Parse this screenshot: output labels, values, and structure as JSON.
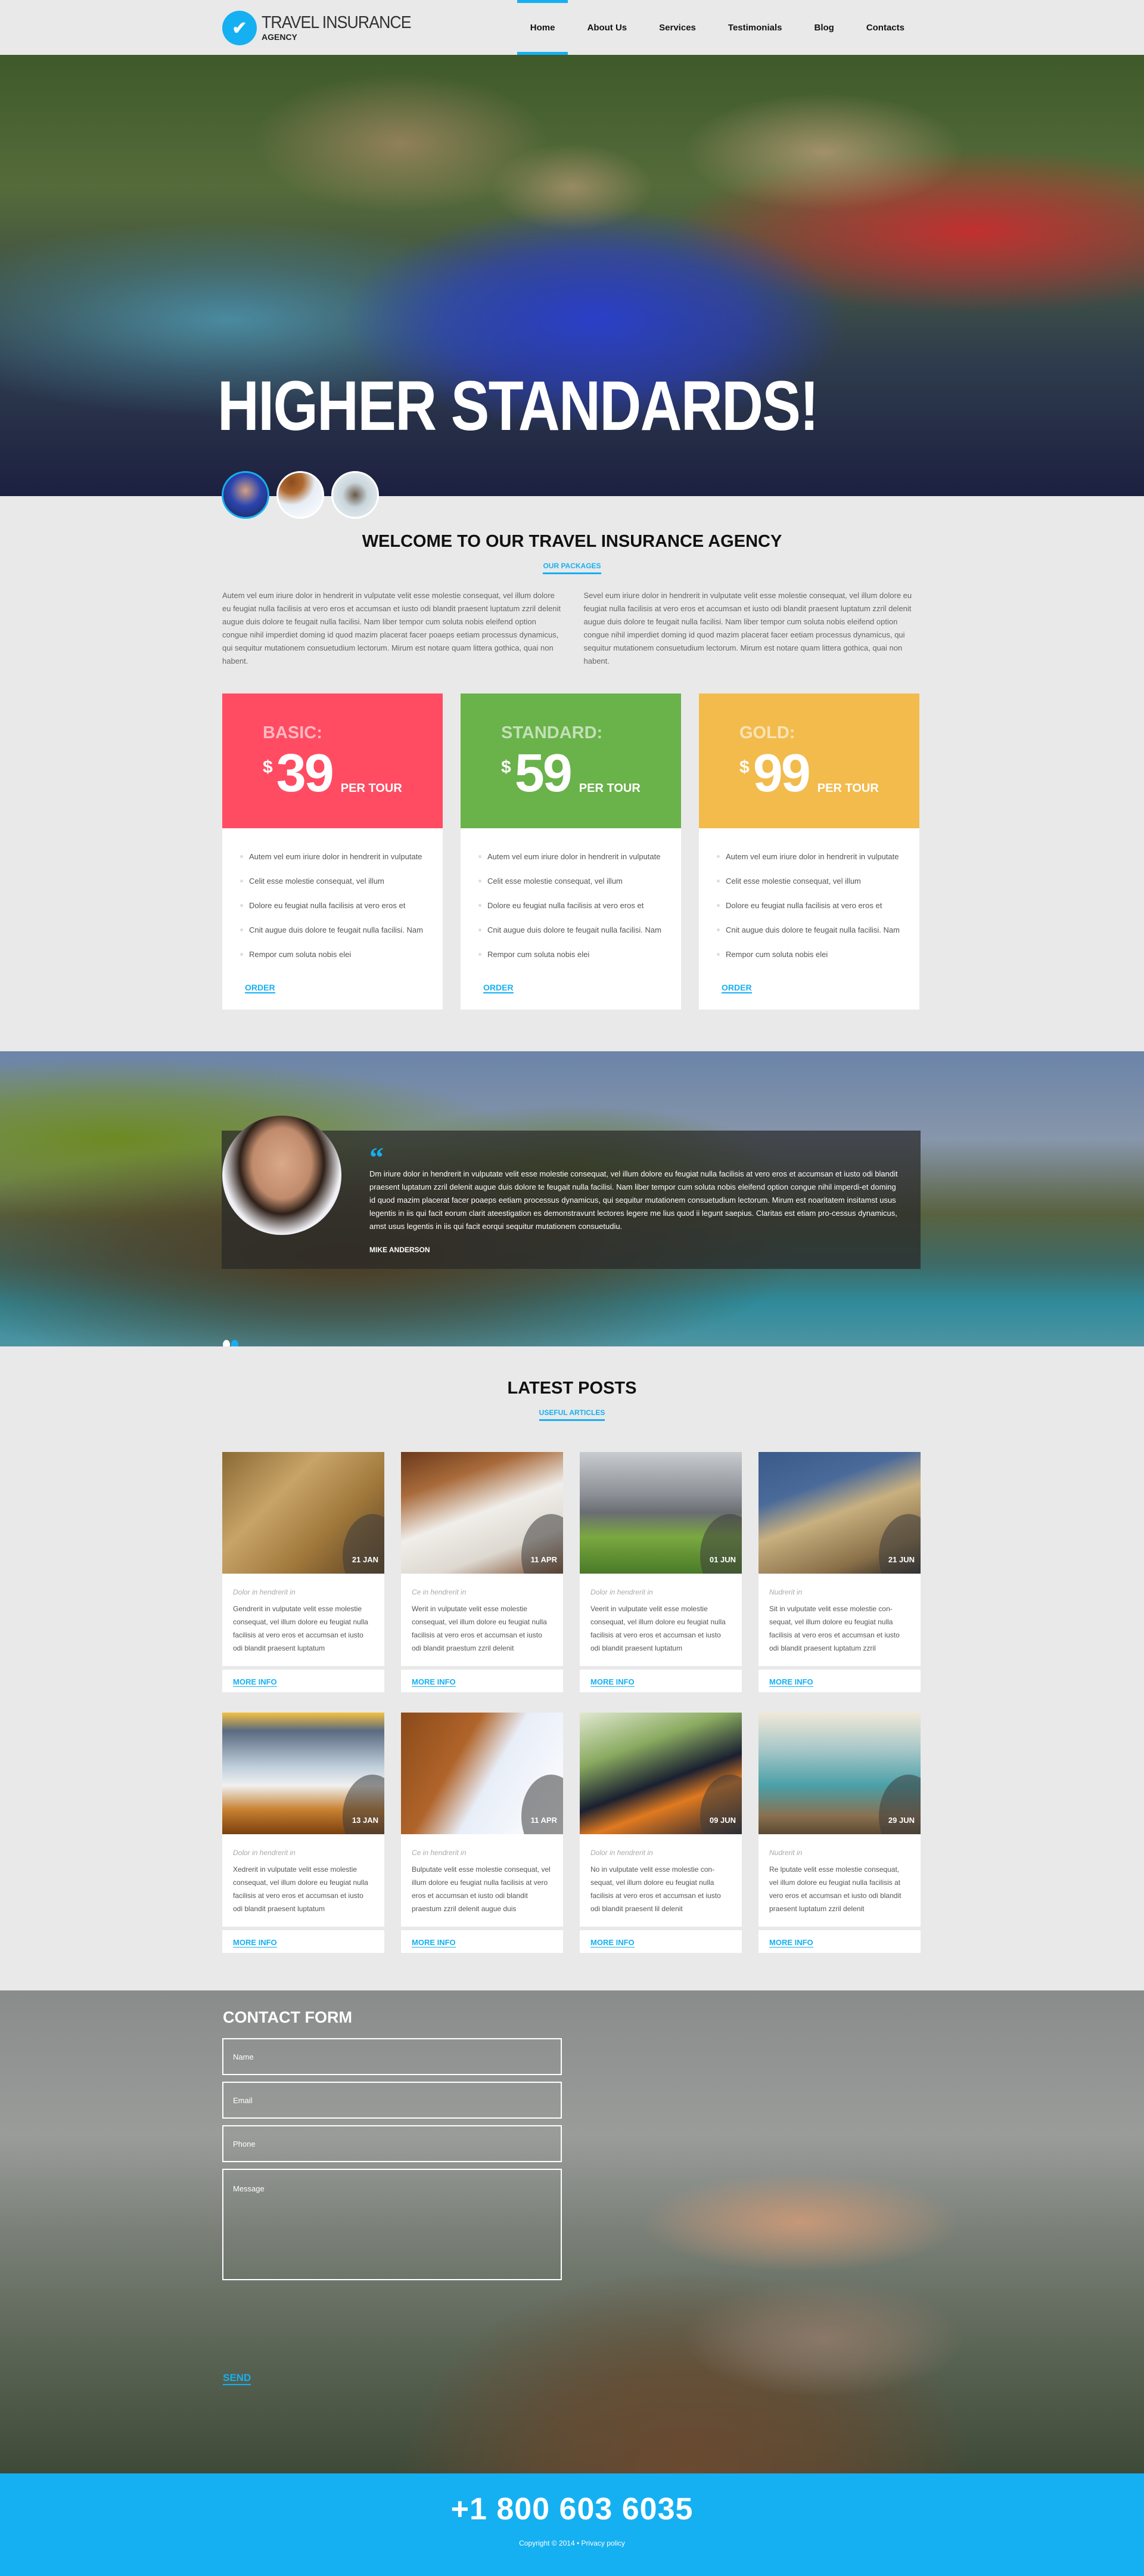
{
  "header": {
    "logo_title": "TRAVEL INSURANCE",
    "logo_subtitle": "AGENCY",
    "logo_icon": "check-icon",
    "nav": [
      {
        "label": "Home",
        "active": true
      },
      {
        "label": "About Us",
        "active": false
      },
      {
        "label": "Services",
        "active": false
      },
      {
        "label": "Testimonials",
        "active": false
      },
      {
        "label": "Blog",
        "active": false
      },
      {
        "label": "Contacts",
        "active": false
      }
    ]
  },
  "hero": {
    "title": "HIGHER STANDARDS!",
    "slide_count": 3,
    "active_slide": 1
  },
  "welcome": {
    "title": "WELCOME TO OUR TRAVEL INSURANCE AGENCY",
    "link": "OUR PACKAGES",
    "col1": "Autem vel eum iriure dolor in hendrerit in vulputate velit esse molestie consequat, vel illum dolore eu feugiat nulla facilisis at vero eros et accumsan et iusto odi blandit praesent luptatum zzril delenit augue duis dolore te feugait nulla facilisi. Nam liber tempor cum soluta nobis eleifend option congue nihil imperdiet doming id quod mazim placerat facer poaeps eetiam processus dynamicus, qui sequitur mutationem consuetudium lectorum. Mirum est notare quam littera gothica, quai non habent.",
    "col2": "Sevel eum iriure dolor in hendrerit in vulputate velit esse molestie consequat, vel illum dolore eu feugiat nulla facilisis at vero eros et accumsan et iusto odi blandit praesent luptatum zzril delenit augue duis dolore te feugait nulla facilisi. Nam liber tempor cum soluta nobis eleifend option congue nihil imperdiet doming id quod mazim placerat facer  eetiam processus dynamicus, qui sequitur mutationem consuetudium lectorum. Mirum est notare quam littera gothica, quai non habent."
  },
  "pricing": [
    {
      "name": "BASIC:",
      "currency": "$",
      "amount": "39",
      "per": "PER TOUR",
      "color": "#ff4c63",
      "features": [
        "Autem vel eum iriure dolor in hendrerit in vulputate",
        "Celit esse molestie consequat, vel illum",
        "Dolore eu feugiat nulla facilisis at vero eros et",
        "Cnit augue duis dolore te feugait nulla facilisi. Nam",
        "Rempor cum soluta nobis elei"
      ],
      "order": "ORDER"
    },
    {
      "name": "STANDARD:",
      "currency": "$",
      "amount": "59",
      "per": "PER TOUR",
      "color": "#6ab24a",
      "features": [
        "Autem vel eum iriure dolor in hendrerit in vulputate",
        "Celit esse molestie consequat, vel illum",
        "Dolore eu feugiat nulla facilisis at vero eros et",
        "Cnit augue duis dolore te feugait nulla facilisi. Nam",
        "Rempor cum soluta nobis elei"
      ],
      "order": "ORDER"
    },
    {
      "name": "GOLD:",
      "currency": "$",
      "amount": "99",
      "per": "PER TOUR",
      "color": "#f2bb4c",
      "features": [
        "Autem vel eum iriure dolor in hendrerit in vulputate",
        "Celit esse molestie consequat, vel illum",
        "Dolore eu feugiat nulla facilisis at vero eros et",
        "Cnit augue duis dolore te feugait nulla facilisi. Nam",
        "Rempor cum soluta nobis elei"
      ],
      "order": "ORDER"
    }
  ],
  "testimonial": {
    "quote_mark": "“",
    "text": "Dm iriure dolor in hendrerit in vulputate velit esse molestie consequat, vel illum dolore eu feugiat nulla facilisis at vero eros et accumsan et iusto odi blandit praesent luptatum zzril delenit augue duis dolore te feugait nulla facilisi. Nam liber tempor cum soluta nobis eleifend option congue nihil imperdi-et doming id quod mazim placerat facer poaeps eetiam processus dynamicus, qui sequitur mutationem consuetudium lectorum. Mirum est noaritatem insitamst usus legentis in iis qui facit eorum clarit ateestigation es demonstravunt lectores legere me lius quod ii legunt saepius. Claritas est etiam pro-cessus dynamicus, amst usus legentis in iis qui facit eorqui sequitur mutationem consuetudiu.",
    "author": "MIKE ANDERSON",
    "slide_count": 2,
    "active_slide": 2
  },
  "posts": {
    "title": "LATEST POSTS",
    "link": "USEFUL ARTICLES",
    "more_label": "MORE INFO",
    "items": [
      {
        "date": "21 JAN",
        "category": "Dolor in hendrerit in",
        "text": "Gendrerit in vulputate velit esse molestie consequat, vel illum dolore eu feugiat nulla facilisis at vero eros et accumsan et iusto odi blandit praesent luptatum"
      },
      {
        "date": "11 APR",
        "category": "Ce in hendrerit in",
        "text": "Werit in vulputate velit esse molestie consequat, vel illum dolore eu feugiat nulla facilisis at vero eros et accumsan et iusto odi blandit praestum zzril delenit"
      },
      {
        "date": "01 JUN",
        "category": "Dolor in hendrerit in",
        "text": "Veerit in vulputate velit esse molestie consequat, vel illum dolore eu feugiat nulla facilisis at vero eros et accumsan et iusto odi blandit praesent luptatum"
      },
      {
        "date": "21 JUN",
        "category": "Nudrerit in",
        "text": "Sit in vulputate velit esse molestie con-sequat, vel illum dolore eu feugiat nulla facilisis at vero eros et accumsan et iusto odi blandit praesent luptatum zzril"
      },
      {
        "date": "13 JAN",
        "category": "Dolor in hendrerit in",
        "text": "Xedrerit in vulputate velit esse molestie consequat, vel illum dolore eu feugiat nulla facilisis at vero eros et accumsan et iusto odi blandit praesent luptatum"
      },
      {
        "date": "11 APR",
        "category": "Ce in hendrerit in",
        "text": "Bulputate velit esse molestie consequat, vel illum dolore eu feugiat nulla facilisis at vero eros et accumsan et iusto odi blandit praestum zzril delenit augue duis"
      },
      {
        "date": "09 JUN",
        "category": "Dolor in hendrerit in",
        "text": "No in vulputate velit esse molestie con-sequat, vel illum dolore eu feugiat nulla facilisis at vero eros et accumsan et iusto odi blandit praesent lil delenit"
      },
      {
        "date": "29 JUN",
        "category": "Nudrerit in",
        "text": "Re lputate velit esse molestie consequat, vel illum dolore eu feugiat nulla facilisis at vero eros et accumsan et iusto odi blandit praesent luptatum zzril delenit"
      }
    ]
  },
  "contact": {
    "title": "CONTACT FORM",
    "name_placeholder": "Name",
    "email_placeholder": "Email",
    "phone_placeholder": "Phone",
    "message_placeholder": "Message",
    "send_label": "SEND"
  },
  "footer": {
    "phone": "+1 800 603 6035",
    "copyright": "Copyright © 2014 • ",
    "privacy": "Privacy policy"
  },
  "colors": {
    "accent": "#15b0f2",
    "basic": "#ff4c63",
    "standard": "#6ab24a",
    "gold": "#f2bb4c",
    "background": "#e9e9e9"
  }
}
